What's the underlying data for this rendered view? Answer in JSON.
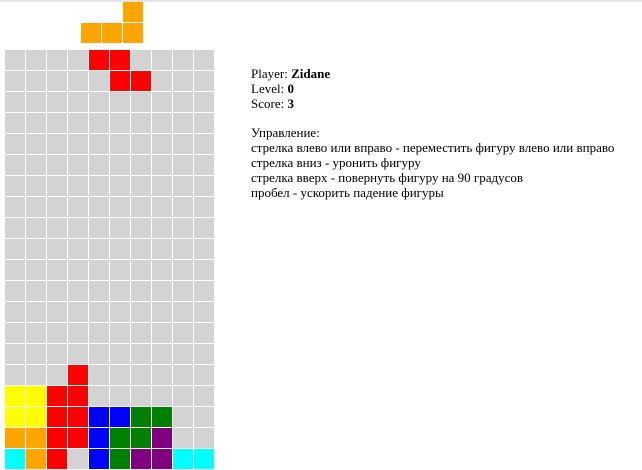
{
  "colors": {
    "empty": "#d3d3d3",
    "yellow": "#ffff00",
    "orange": "#ffa500",
    "red": "#ff0000",
    "blue": "#0000ff",
    "green": "#008000",
    "purple": "#800080",
    "cyan": "#00ffff"
  },
  "next_piece": {
    "rows": [
      [
        null,
        null,
        "orange"
      ],
      [
        "orange",
        "orange",
        "orange"
      ]
    ]
  },
  "board": {
    "rows": [
      [
        null,
        null,
        null,
        null,
        "red",
        "red",
        null,
        null,
        null,
        null
      ],
      [
        null,
        null,
        null,
        null,
        null,
        "red",
        "red",
        null,
        null,
        null
      ],
      [
        null,
        null,
        null,
        null,
        null,
        null,
        null,
        null,
        null,
        null
      ],
      [
        null,
        null,
        null,
        null,
        null,
        null,
        null,
        null,
        null,
        null
      ],
      [
        null,
        null,
        null,
        null,
        null,
        null,
        null,
        null,
        null,
        null
      ],
      [
        null,
        null,
        null,
        null,
        null,
        null,
        null,
        null,
        null,
        null
      ],
      [
        null,
        null,
        null,
        null,
        null,
        null,
        null,
        null,
        null,
        null
      ],
      [
        null,
        null,
        null,
        null,
        null,
        null,
        null,
        null,
        null,
        null
      ],
      [
        null,
        null,
        null,
        null,
        null,
        null,
        null,
        null,
        null,
        null
      ],
      [
        null,
        null,
        null,
        null,
        null,
        null,
        null,
        null,
        null,
        null
      ],
      [
        null,
        null,
        null,
        null,
        null,
        null,
        null,
        null,
        null,
        null
      ],
      [
        null,
        null,
        null,
        null,
        null,
        null,
        null,
        null,
        null,
        null
      ],
      [
        null,
        null,
        null,
        null,
        null,
        null,
        null,
        null,
        null,
        null
      ],
      [
        null,
        null,
        null,
        null,
        null,
        null,
        null,
        null,
        null,
        null
      ],
      [
        null,
        null,
        null,
        null,
        null,
        null,
        null,
        null,
        null,
        null
      ],
      [
        null,
        null,
        null,
        "red",
        null,
        null,
        null,
        null,
        null,
        null
      ],
      [
        "yellow",
        "yellow",
        "red",
        "red",
        null,
        null,
        null,
        null,
        null,
        null
      ],
      [
        "yellow",
        "yellow",
        "red",
        "red",
        "blue",
        "blue",
        "green",
        "green",
        null,
        null
      ],
      [
        "orange",
        "orange",
        "red",
        "red",
        "blue",
        "green",
        "green",
        "purple",
        null,
        null
      ],
      [
        "cyan",
        "orange",
        "red",
        null,
        "blue",
        "green",
        "purple",
        "purple",
        "cyan",
        "cyan"
      ]
    ]
  },
  "info": {
    "player_label": "Player: ",
    "player_name": "Zidane",
    "level_label": "Level: ",
    "level_value": "0",
    "score_label": "Score: ",
    "score_value": "3"
  },
  "controls": {
    "title": "Управление:",
    "lines": [
      "стрелка влево или вправо - переместить фигуру влево или вправо",
      "стрелка вниз - уронить фигуру",
      "стрелка вверх - повернуть фигуру на 90 градусов",
      "пробел - ускорить падение фигуры"
    ]
  }
}
